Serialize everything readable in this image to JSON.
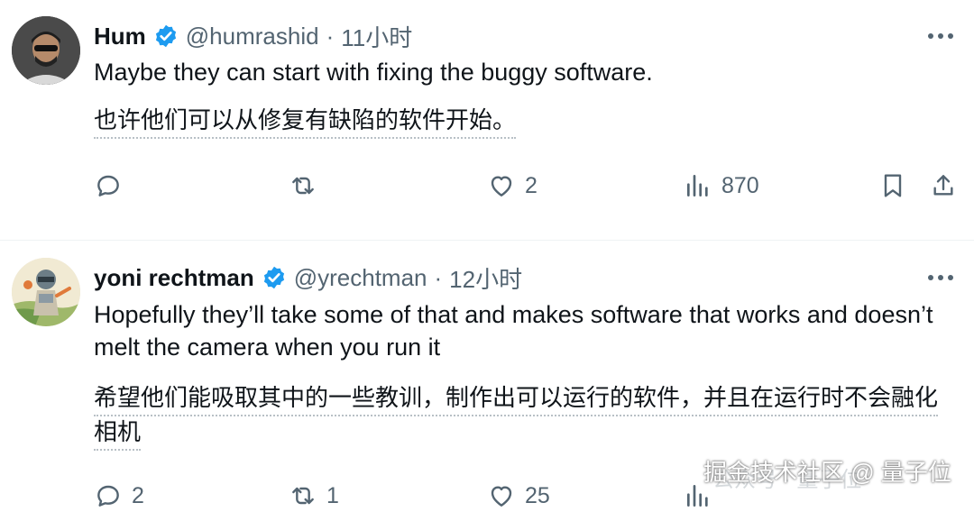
{
  "tweets": [
    {
      "name": "Hum",
      "handle": "@humrashid",
      "separator": "·",
      "time": "11小时",
      "text": "Maybe they can start with fixing the buggy software.",
      "translation": "也许他们可以从修复有缺陷的软件开始。",
      "replies": "",
      "reposts": "",
      "likes": "2",
      "views": "870",
      "avatar_color": "#3a3a3a"
    },
    {
      "name": "yoni rechtman",
      "handle": "@yrechtman",
      "separator": "·",
      "time": "12小时",
      "text": "Hopefully they’ll take some of that and makes software that works and doesn’t melt the camera when you run it",
      "translation": "希望他们能吸取其中的一些教训，制作出可以运行的软件，并且在运行时不会融化相机",
      "replies": "2",
      "reposts": "1",
      "likes": "25",
      "views": "",
      "avatar_color": "#e8e2cf"
    }
  ],
  "watermark": {
    "faint": "公众号 · 量子位",
    "main": "掘金技术社区 @ 量子位"
  },
  "colors": {
    "verified": "#1d9bf0",
    "secondary": "#536471",
    "primary": "#0f1419"
  }
}
